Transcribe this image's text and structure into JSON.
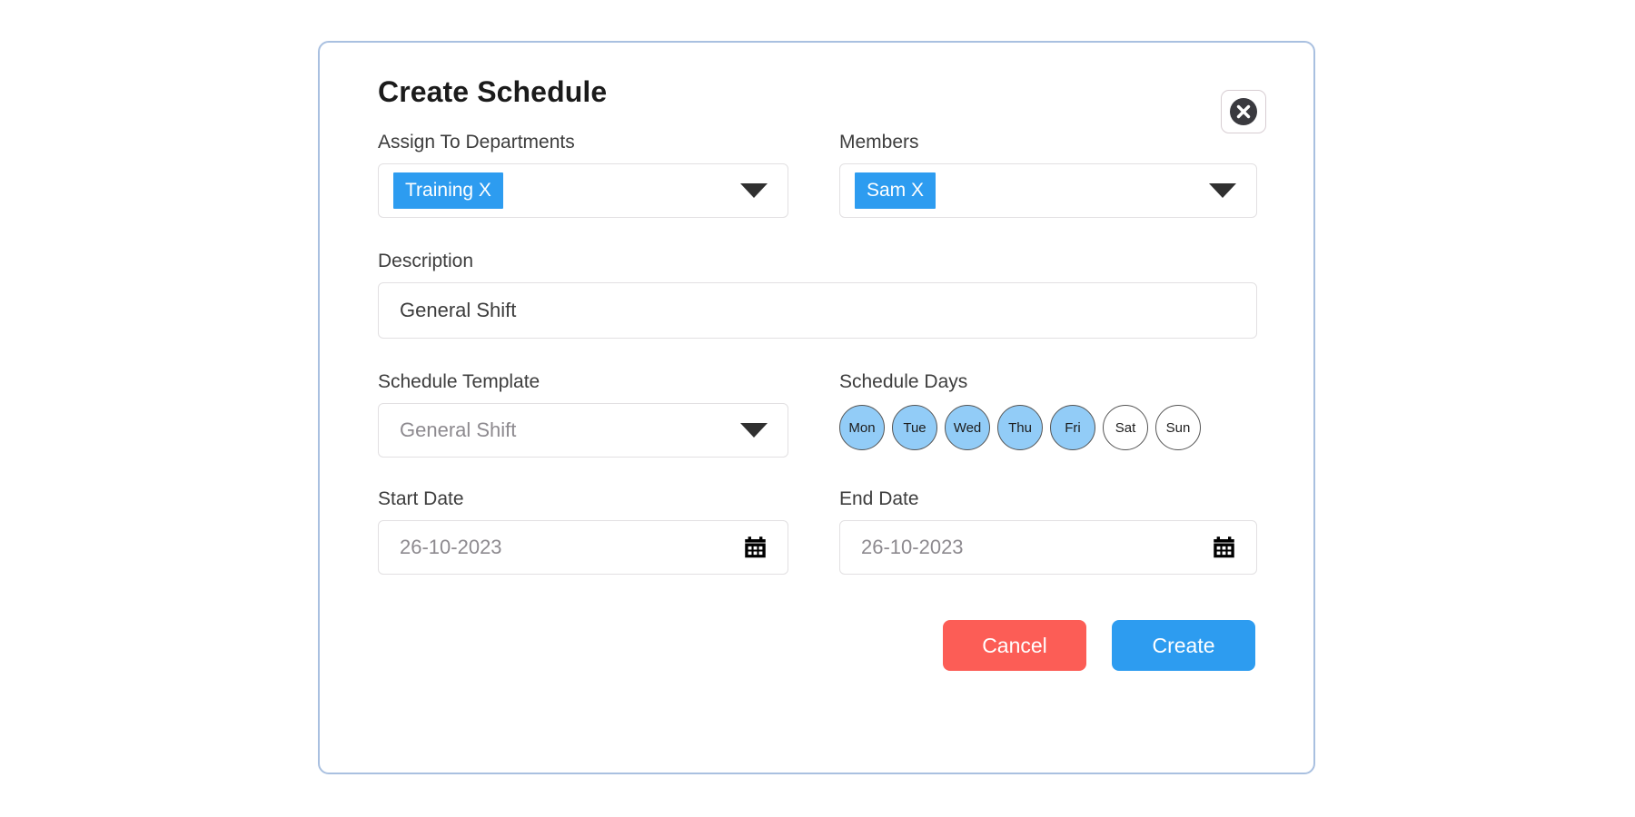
{
  "modal": {
    "title": "Create Schedule",
    "close_label": "close-icon",
    "accent_blue": "#2d9cf0",
    "danger_red": "#fc5d56",
    "day_selected_fill": "#92ccf7",
    "border_color": "#a9c0e0"
  },
  "fields": {
    "departments": {
      "label": "Assign To Departments",
      "chips": [
        "Training X"
      ],
      "caret": "chevron-down-icon"
    },
    "members": {
      "label": "Members",
      "chips": [
        "Sam X"
      ],
      "caret": "chevron-down-icon"
    },
    "description": {
      "label": "Description",
      "value": "General Shift"
    },
    "schedule_template": {
      "label": "Schedule Template",
      "value": "General Shift",
      "caret": "chevron-down-icon"
    },
    "schedule_days": {
      "label": "Schedule Days",
      "days": [
        {
          "label": "Mon",
          "selected": true
        },
        {
          "label": "Tue",
          "selected": true
        },
        {
          "label": "Wed",
          "selected": true
        },
        {
          "label": "Thu",
          "selected": true
        },
        {
          "label": "Fri",
          "selected": true
        },
        {
          "label": "Sat",
          "selected": false
        },
        {
          "label": "Sun",
          "selected": false
        }
      ]
    },
    "start_date": {
      "label": "Start Date",
      "value": "26-10-2023",
      "icon": "calendar-icon"
    },
    "end_date": {
      "label": "End Date",
      "value": "26-10-2023",
      "icon": "calendar-icon"
    }
  },
  "footer": {
    "cancel_label": "Cancel",
    "create_label": "Create"
  }
}
